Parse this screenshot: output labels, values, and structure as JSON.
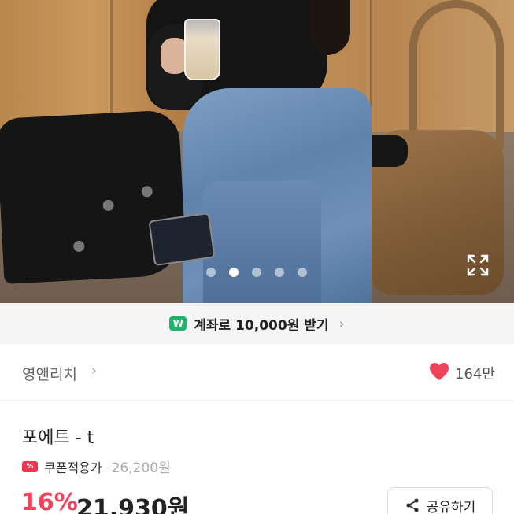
{
  "gallery": {
    "slide_count": 5,
    "active_index": 1,
    "expand_icon": "expand-icon"
  },
  "banner": {
    "badge": "W",
    "text": "계좌로 10,000원 받기",
    "chevron": "›",
    "accent": "#1fb36b"
  },
  "shop": {
    "name": "영앤리치",
    "chevron": "›",
    "likes": "164만",
    "heart_color": "#f0435b"
  },
  "product": {
    "title": "포에트 - t",
    "coupon_badge": "%",
    "coupon_label": "쿠폰적용가",
    "original_price": "26,200원",
    "discount": "16%",
    "price": "21,930원",
    "discount_color": "#f0435b"
  },
  "actions": {
    "share_label": "공유하기"
  }
}
